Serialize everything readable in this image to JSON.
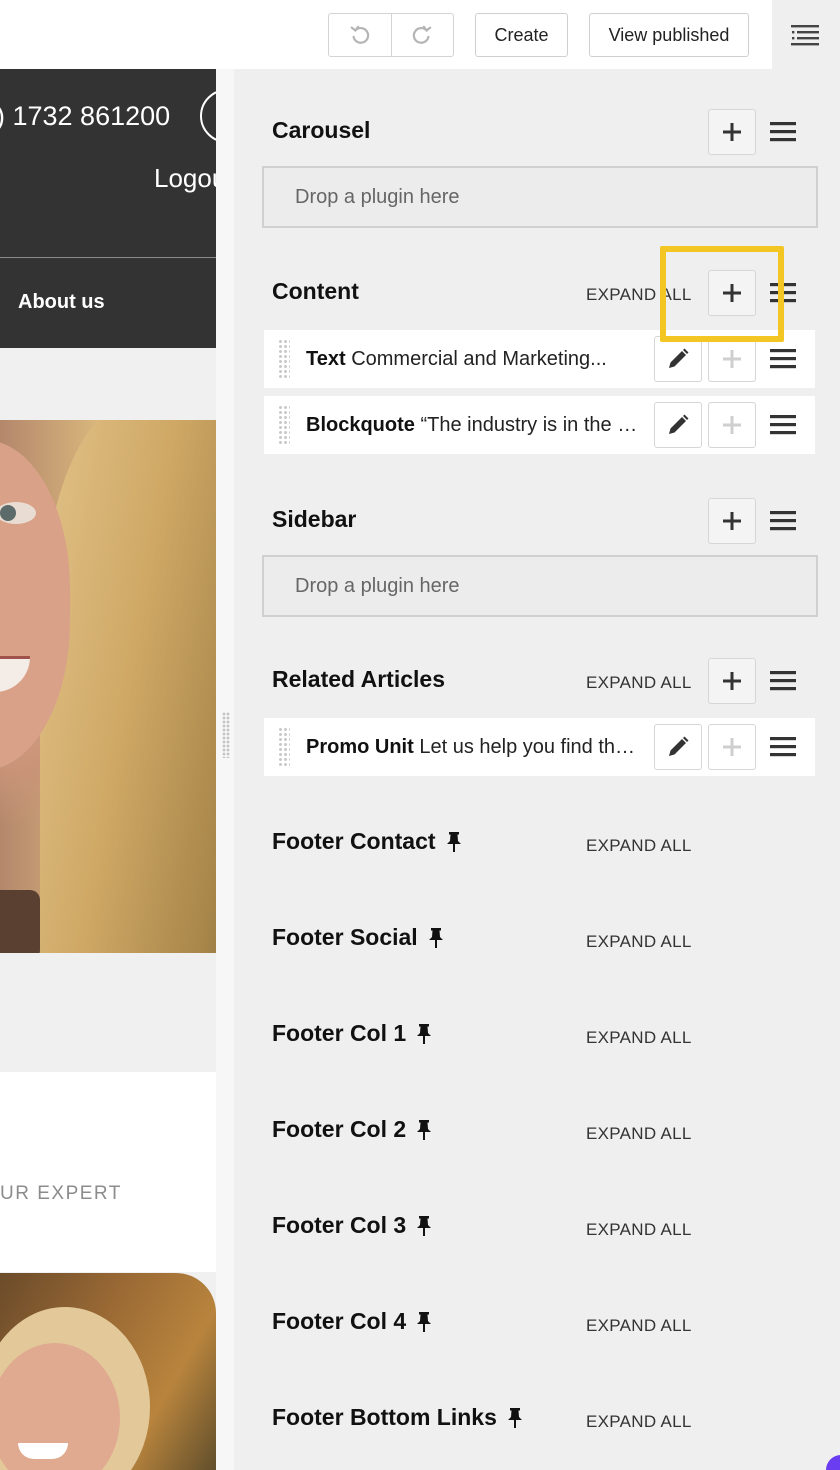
{
  "toolbar": {
    "undo_icon": "undo-icon",
    "redo_icon": "redo-icon",
    "create_label": "Create",
    "view_published_label": "View published",
    "structure_icon": "structure-toggle-icon"
  },
  "site": {
    "phone": ") 1732 861200",
    "logout": "Logou",
    "nav_item": "About us",
    "expert_text": "UR EXPERT"
  },
  "panel": {
    "expand_all": "EXPAND ALL",
    "drop_placeholder": "Drop a plugin here",
    "placeholders": [
      {
        "title": "Carousel"
      },
      {
        "title": "Content"
      },
      {
        "title": "Sidebar"
      },
      {
        "title": "Related Articles"
      },
      {
        "title": "Footer Contact"
      },
      {
        "title": "Footer Social"
      },
      {
        "title": "Footer Col 1"
      },
      {
        "title": "Footer Col 2"
      },
      {
        "title": "Footer Col 3"
      },
      {
        "title": "Footer Col 4"
      },
      {
        "title": "Footer Bottom Links"
      }
    ],
    "content_plugins": [
      {
        "type": "Text",
        "summary": " Commercial and Marketing..."
      },
      {
        "type": "Blockquote",
        "summary": " “The industry is in the middle of a transformation"
      }
    ],
    "related_plugins": [
      {
        "type": "Promo Unit",
        "summary": " Let us help you find the right role"
      }
    ]
  },
  "colors": {
    "highlight": "#f3c623",
    "site_header": "#333333",
    "panel_bg": "#efefef"
  }
}
